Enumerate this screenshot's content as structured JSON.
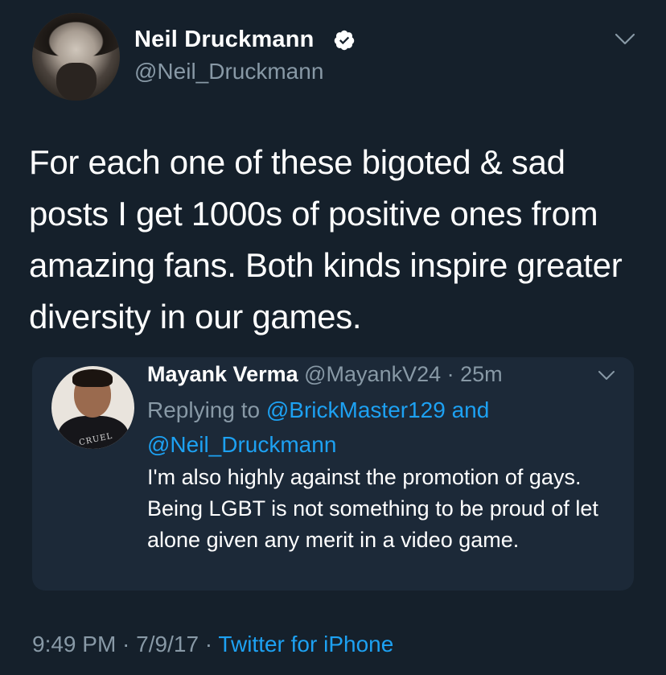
{
  "author": {
    "name": "Neil Druckmann",
    "handle": "@Neil_Druckmann",
    "verified": true
  },
  "tweet": {
    "text": "For each one of these bigoted & sad posts I get 1000s of positive ones from amazing fans. Both kinds inspire greater diversity in our games."
  },
  "quoted": {
    "name": "Mayank Verma",
    "handle": "@MayankV24",
    "separator": " · ",
    "time": "25m",
    "replying_prefix": "Replying to ",
    "replying_mention_1": "@BrickMaster129",
    "replying_and": " and",
    "replying_mention_2": "@Neil_Druckmann",
    "text": "I'm also highly against the promotion of gays. Being LGBT is not something to be proud of let alone given any merit in a video game.",
    "avatar_shirt_text": "CRUEL"
  },
  "footer": {
    "time": "9:49 PM",
    "separator_1": " · ",
    "date": "7/9/17",
    "separator_2": " · ",
    "source": "Twitter for iPhone"
  },
  "icons": {
    "verified": "verified-badge-icon",
    "menu": "chevron-down-icon"
  },
  "colors": {
    "background": "#15202b",
    "card": "#1c2938",
    "secondary_text": "#8899a6",
    "link": "#1da1f2"
  }
}
